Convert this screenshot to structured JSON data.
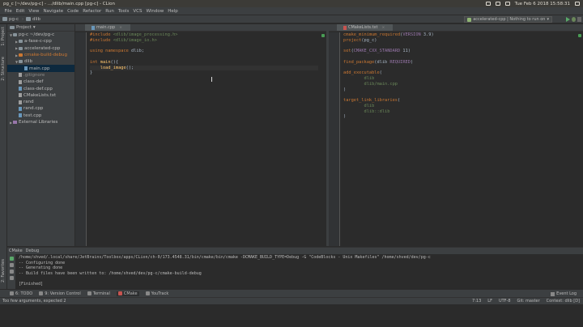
{
  "window": {
    "title": "pg_c [~/dev/pg-c] - .../dlib/main.cpp [pg-c] - CLion",
    "clock": "Tue Feb 6 2018 15:58:31"
  },
  "menu": [
    "File",
    "Edit",
    "View",
    "Navigate",
    "Code",
    "Refactor",
    "Run",
    "Tools",
    "VCS",
    "Window",
    "Help"
  ],
  "breadcrumbs": [
    "pg-c",
    "dlib"
  ],
  "run_config": "accelerated-cpp | Nothing to run on",
  "left_tabs": [
    "1: Project",
    "2: Structure",
    "2: Favorites"
  ],
  "project": {
    "header": "Project",
    "tree": [
      {
        "label": "pg-c  ~/dev/pg-c",
        "indent": 0,
        "kind": "folder",
        "open": true
      },
      {
        "label": "a-fase-c-cpp",
        "indent": 1,
        "kind": "folder",
        "open": false
      },
      {
        "label": "accelerated-cpp",
        "indent": 1,
        "kind": "folder",
        "open": false
      },
      {
        "label": "cmake-build-debug",
        "indent": 1,
        "kind": "gen",
        "open": false
      },
      {
        "label": "dlib",
        "indent": 1,
        "kind": "folder",
        "open": true
      },
      {
        "label": "main.cpp",
        "indent": 2,
        "kind": "cpp",
        "selected": true
      },
      {
        "label": ".gitignore",
        "indent": 1,
        "kind": "txt"
      },
      {
        "label": "class-def",
        "indent": 1,
        "kind": "txt"
      },
      {
        "label": "class-def.cpp",
        "indent": 1,
        "kind": "cpp"
      },
      {
        "label": "CMakeLists.txt",
        "indent": 1,
        "kind": "txt"
      },
      {
        "label": "rand",
        "indent": 1,
        "kind": "txt"
      },
      {
        "label": "rand.cpp",
        "indent": 1,
        "kind": "cpp"
      },
      {
        "label": "test.cpp",
        "indent": 1,
        "kind": "cpp"
      },
      {
        "label": "External Libraries",
        "indent": 0,
        "kind": "lib",
        "open": false
      }
    ]
  },
  "editor_left": {
    "tab": "main.cpp",
    "lines": [
      "#include <dlib/image_processing.h>",
      "#include <dlib/image_io.h>",
      "",
      "using namespace dlib;",
      "",
      "int main(){",
      "    load_image();",
      "}"
    ]
  },
  "editor_right": {
    "tab": "CMakeLists.txt",
    "lines": [
      "cmake_minimum_required(VERSION 3.9)",
      "project(pg_c)",
      "",
      "set(CMAKE_CXX_STANDARD 11)",
      "",
      "find_package(dlib REQUIRED)",
      "",
      "add_executable(",
      "        dlib",
      "        dlib/main.cpp",
      ")",
      "",
      "target_link_libraries(",
      "        dlib",
      "        dlib::dlib",
      ")"
    ]
  },
  "bottom": {
    "tabs": [
      "CMake",
      "Debug"
    ],
    "console": [
      "/home/shved/.local/share/JetBrains/Toolbox/apps/CLion/ch-0/173.4548.31/bin/cmake/bin/cmake -DCMAKE_BUILD_TYPE=Debug -G \"CodeBlocks - Unix Makefiles\" /home/shved/dev/pg-c",
      "-- Configuring done",
      "-- Generating done",
      "-- Build files have been written to: /home/shved/dev/pg-c/cmake-build-debug",
      "",
      "[Finished]"
    ]
  },
  "toolwindows": [
    "6: TODO",
    "9: Version Control",
    "Terminal",
    "CMake",
    "YouTrack"
  ],
  "event_log": "Event Log",
  "status": {
    "message": "Too few arguments, expected 2",
    "position": "7:13",
    "line_sep": "LF",
    "encoding": "UTF-8",
    "git": "Git: master",
    "context": "Context: dlib [D]"
  }
}
